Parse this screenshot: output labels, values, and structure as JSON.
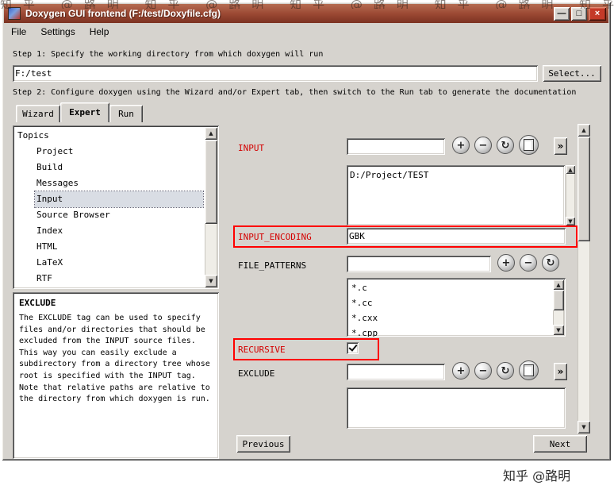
{
  "window": {
    "title": "Doxygen GUI frontend (F:/test/Doxyfile.cfg)"
  },
  "icons": {
    "minimize": "—",
    "maximize": "□",
    "close": "×",
    "add": "+",
    "remove": "−",
    "refresh": "↻",
    "more": "»",
    "up": "▲",
    "down": "▼",
    "left": "◄",
    "right": "►"
  },
  "menu": {
    "file": "File",
    "settings": "Settings",
    "help": "Help"
  },
  "steps": {
    "step1": "Step 1: Specify the working directory from which doxygen will run",
    "step2": "Step 2: Configure doxygen using the Wizard and/or Expert tab, then switch to the Run tab to generate the documentation"
  },
  "working_dir": {
    "value": "F:/test",
    "select_button": "Select..."
  },
  "tabs": {
    "wizard": "Wizard",
    "expert": "Expert",
    "run": "Run"
  },
  "topics": {
    "header": "Topics",
    "items": [
      "Project",
      "Build",
      "Messages",
      "Input",
      "Source Browser",
      "Index",
      "HTML",
      "LaTeX",
      "RTF"
    ],
    "selected": "Input"
  },
  "help_panel": {
    "title": "EXCLUDE",
    "body": "The EXCLUDE tag can be used to specify\nfiles and/or directories that should be\nexcluded from the INPUT source files.\nThis way you can easily exclude a\nsubdirectory from a directory tree whose\nroot is specified with the INPUT tag.\nNote that relative paths are relative to\nthe directory from which doxygen is run."
  },
  "form": {
    "input": {
      "label": "INPUT",
      "field": "",
      "items": [
        "D:/Project/TEST"
      ]
    },
    "input_encoding": {
      "label": "INPUT_ENCODING",
      "field": "GBK"
    },
    "file_patterns": {
      "label": "FILE_PATTERNS",
      "field": "",
      "items": [
        "*.c",
        "*.cc",
        "*.cxx",
        "*.cpp"
      ]
    },
    "recursive": {
      "label": "RECURSIVE",
      "checked": true
    },
    "exclude": {
      "label": "EXCLUDE",
      "field": "",
      "items": []
    }
  },
  "nav": {
    "previous": "Previous",
    "next": "Next"
  },
  "watermark": {
    "top": "知乎 @路明 知乎 @路明 知乎 @路明 知乎 @路明 知乎 @路明",
    "bottom": "知乎 @路明"
  },
  "colors": {
    "titlebar_top": "#b56c52",
    "titlebar_bottom": "#7c3222",
    "chrome": "#d6d3ce",
    "changed_label": "#d40000",
    "annotation": "#ff0000"
  }
}
